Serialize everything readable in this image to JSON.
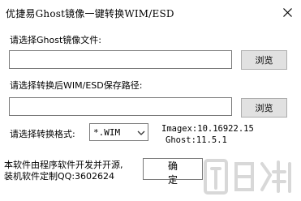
{
  "window": {
    "title": "优捷易Ghost镜像一键转换WIM/ESD",
    "close_glyph": "✕"
  },
  "source": {
    "label": "请选择Ghost镜像文件:",
    "path_value": "",
    "browse_label": "浏览"
  },
  "target": {
    "label": "请选择转换后WIM/ESD保存路径:",
    "path_value": "",
    "browse_label": "浏览"
  },
  "format": {
    "label": "请选择转换格式:",
    "selected": "*.WIM"
  },
  "info": {
    "imagex": "Imagex:10.16922.15",
    "ghost": "Ghost:11.5.1"
  },
  "footer": {
    "line1": "本软件由程序软件开发并开源,",
    "line2": "装机软件定制QQ:3602624"
  },
  "ok_label": "确 定",
  "watermark_text": "下载"
}
